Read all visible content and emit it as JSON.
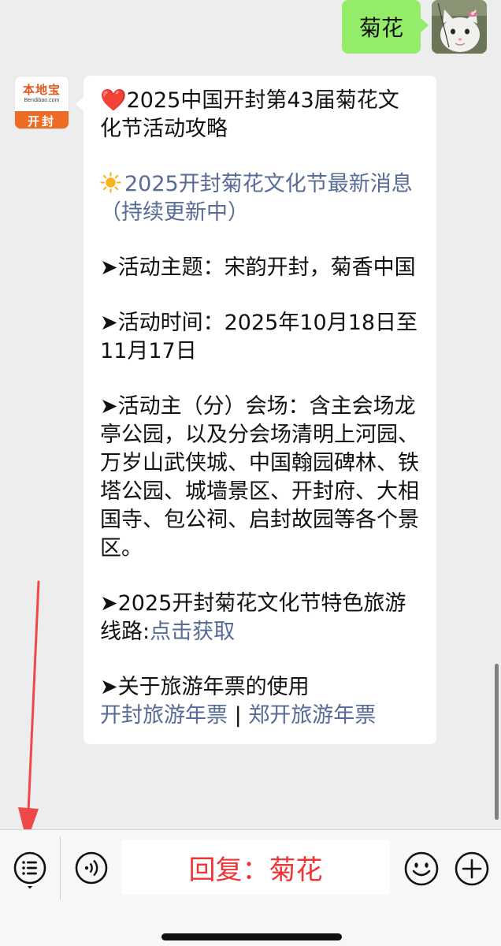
{
  "outgoing_message": {
    "text": "菊花",
    "avatar_icon": "cat-avatar"
  },
  "incoming_message": {
    "sender_avatar": {
      "logo_text": "本地宝",
      "logo_domain": "Bendibao.com",
      "city": "开封"
    },
    "title_emoji": "❤️",
    "title": "2025中国开封第43届菊花文化节活动攻略",
    "news_link_emoji": "sun-icon",
    "news_link": "2025开封菊花文化节最新消息（持续更新中）",
    "theme": "➤活动主题：宋韵开封，菊香中国",
    "time": "➤活动时间：2025年10月18日至11月17日",
    "venues": "➤活动主（分）会场：含主会场龙亭公园，以及分会场清明上河园、万岁山武侠城、中国翰园碑林、铁塔公园、城墙景区、开封府、大相国寺、包公祠、启封故园等各个景区。",
    "route_prefix": "➤2025开封菊花文化节特色旅游线路:",
    "route_link": "点击获取",
    "ticket_heading": "➤关于旅游年票的使用",
    "ticket_link_1": "开封旅游年票",
    "ticket_separator": " | ",
    "ticket_link_2": "郑开旅游年票"
  },
  "input_bar": {
    "reply_hint": "回复：菊花",
    "menu_icon": "list-menu-icon",
    "voice_icon": "voice-icon",
    "emoji_icon": "smiley-icon",
    "plus_icon": "plus-icon"
  },
  "colors": {
    "chat_background": "#ededed",
    "outgoing_bubble": "#95ec69",
    "incoming_bubble": "#ffffff",
    "link": "#576b95",
    "annotation_red": "#ee3535",
    "brand_orange": "#ed6b22"
  }
}
